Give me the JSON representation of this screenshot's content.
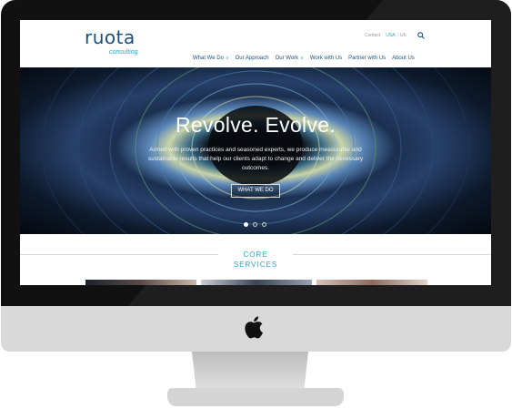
{
  "brand": {
    "wordmark": "ruota",
    "sub": "consulting"
  },
  "utility": {
    "contact": "Contact",
    "usa": "USA",
    "separator": "|",
    "uk": "UK"
  },
  "nav": {
    "items": [
      {
        "label": "What We Do",
        "dropdown": true
      },
      {
        "label": "Our Approach",
        "dropdown": false
      },
      {
        "label": "Our Work",
        "dropdown": true
      },
      {
        "label": "Work with Us",
        "dropdown": false
      },
      {
        "label": "Partner with Us",
        "dropdown": false
      },
      {
        "label": "About Us",
        "dropdown": false
      }
    ]
  },
  "hero": {
    "title": "Revolve. Evolve.",
    "body": "Armed with proven practices and seasoned experts, we produce measurable and sustainable results that help our clients adapt to change and deliver the necessary outcomes.",
    "button": "WHAT WE DO",
    "slides_total": 3,
    "slide_active": 1
  },
  "services": {
    "title_line1": "CORE",
    "title_line2": "SERVICES"
  },
  "colors": {
    "brand_navy": "#1d4f7a",
    "brand_teal": "#2ba6c8"
  },
  "icons": [
    "search-icon",
    "chevron-down-icon",
    "apple-logo-icon"
  ]
}
